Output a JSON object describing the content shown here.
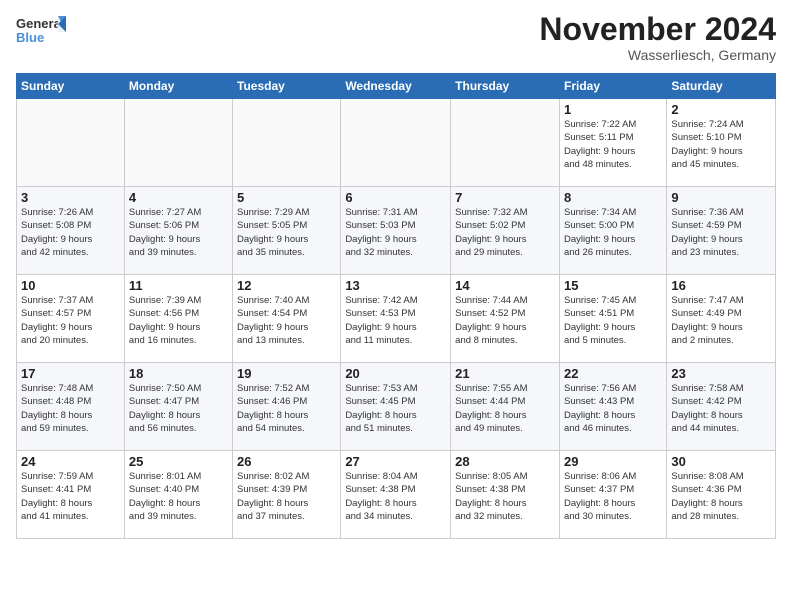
{
  "logo": {
    "line1": "General",
    "line2": "Blue"
  },
  "title": "November 2024",
  "subtitle": "Wasserliesch, Germany",
  "days_of_week": [
    "Sunday",
    "Monday",
    "Tuesday",
    "Wednesday",
    "Thursday",
    "Friday",
    "Saturday"
  ],
  "weeks": [
    [
      {
        "day": "",
        "info": ""
      },
      {
        "day": "",
        "info": ""
      },
      {
        "day": "",
        "info": ""
      },
      {
        "day": "",
        "info": ""
      },
      {
        "day": "",
        "info": ""
      },
      {
        "day": "1",
        "info": "Sunrise: 7:22 AM\nSunset: 5:11 PM\nDaylight: 9 hours\nand 48 minutes."
      },
      {
        "day": "2",
        "info": "Sunrise: 7:24 AM\nSunset: 5:10 PM\nDaylight: 9 hours\nand 45 minutes."
      }
    ],
    [
      {
        "day": "3",
        "info": "Sunrise: 7:26 AM\nSunset: 5:08 PM\nDaylight: 9 hours\nand 42 minutes."
      },
      {
        "day": "4",
        "info": "Sunrise: 7:27 AM\nSunset: 5:06 PM\nDaylight: 9 hours\nand 39 minutes."
      },
      {
        "day": "5",
        "info": "Sunrise: 7:29 AM\nSunset: 5:05 PM\nDaylight: 9 hours\nand 35 minutes."
      },
      {
        "day": "6",
        "info": "Sunrise: 7:31 AM\nSunset: 5:03 PM\nDaylight: 9 hours\nand 32 minutes."
      },
      {
        "day": "7",
        "info": "Sunrise: 7:32 AM\nSunset: 5:02 PM\nDaylight: 9 hours\nand 29 minutes."
      },
      {
        "day": "8",
        "info": "Sunrise: 7:34 AM\nSunset: 5:00 PM\nDaylight: 9 hours\nand 26 minutes."
      },
      {
        "day": "9",
        "info": "Sunrise: 7:36 AM\nSunset: 4:59 PM\nDaylight: 9 hours\nand 23 minutes."
      }
    ],
    [
      {
        "day": "10",
        "info": "Sunrise: 7:37 AM\nSunset: 4:57 PM\nDaylight: 9 hours\nand 20 minutes."
      },
      {
        "day": "11",
        "info": "Sunrise: 7:39 AM\nSunset: 4:56 PM\nDaylight: 9 hours\nand 16 minutes."
      },
      {
        "day": "12",
        "info": "Sunrise: 7:40 AM\nSunset: 4:54 PM\nDaylight: 9 hours\nand 13 minutes."
      },
      {
        "day": "13",
        "info": "Sunrise: 7:42 AM\nSunset: 4:53 PM\nDaylight: 9 hours\nand 11 minutes."
      },
      {
        "day": "14",
        "info": "Sunrise: 7:44 AM\nSunset: 4:52 PM\nDaylight: 9 hours\nand 8 minutes."
      },
      {
        "day": "15",
        "info": "Sunrise: 7:45 AM\nSunset: 4:51 PM\nDaylight: 9 hours\nand 5 minutes."
      },
      {
        "day": "16",
        "info": "Sunrise: 7:47 AM\nSunset: 4:49 PM\nDaylight: 9 hours\nand 2 minutes."
      }
    ],
    [
      {
        "day": "17",
        "info": "Sunrise: 7:48 AM\nSunset: 4:48 PM\nDaylight: 8 hours\nand 59 minutes."
      },
      {
        "day": "18",
        "info": "Sunrise: 7:50 AM\nSunset: 4:47 PM\nDaylight: 8 hours\nand 56 minutes."
      },
      {
        "day": "19",
        "info": "Sunrise: 7:52 AM\nSunset: 4:46 PM\nDaylight: 8 hours\nand 54 minutes."
      },
      {
        "day": "20",
        "info": "Sunrise: 7:53 AM\nSunset: 4:45 PM\nDaylight: 8 hours\nand 51 minutes."
      },
      {
        "day": "21",
        "info": "Sunrise: 7:55 AM\nSunset: 4:44 PM\nDaylight: 8 hours\nand 49 minutes."
      },
      {
        "day": "22",
        "info": "Sunrise: 7:56 AM\nSunset: 4:43 PM\nDaylight: 8 hours\nand 46 minutes."
      },
      {
        "day": "23",
        "info": "Sunrise: 7:58 AM\nSunset: 4:42 PM\nDaylight: 8 hours\nand 44 minutes."
      }
    ],
    [
      {
        "day": "24",
        "info": "Sunrise: 7:59 AM\nSunset: 4:41 PM\nDaylight: 8 hours\nand 41 minutes."
      },
      {
        "day": "25",
        "info": "Sunrise: 8:01 AM\nSunset: 4:40 PM\nDaylight: 8 hours\nand 39 minutes."
      },
      {
        "day": "26",
        "info": "Sunrise: 8:02 AM\nSunset: 4:39 PM\nDaylight: 8 hours\nand 37 minutes."
      },
      {
        "day": "27",
        "info": "Sunrise: 8:04 AM\nSunset: 4:38 PM\nDaylight: 8 hours\nand 34 minutes."
      },
      {
        "day": "28",
        "info": "Sunrise: 8:05 AM\nSunset: 4:38 PM\nDaylight: 8 hours\nand 32 minutes."
      },
      {
        "day": "29",
        "info": "Sunrise: 8:06 AM\nSunset: 4:37 PM\nDaylight: 8 hours\nand 30 minutes."
      },
      {
        "day": "30",
        "info": "Sunrise: 8:08 AM\nSunset: 4:36 PM\nDaylight: 8 hours\nand 28 minutes."
      }
    ]
  ]
}
